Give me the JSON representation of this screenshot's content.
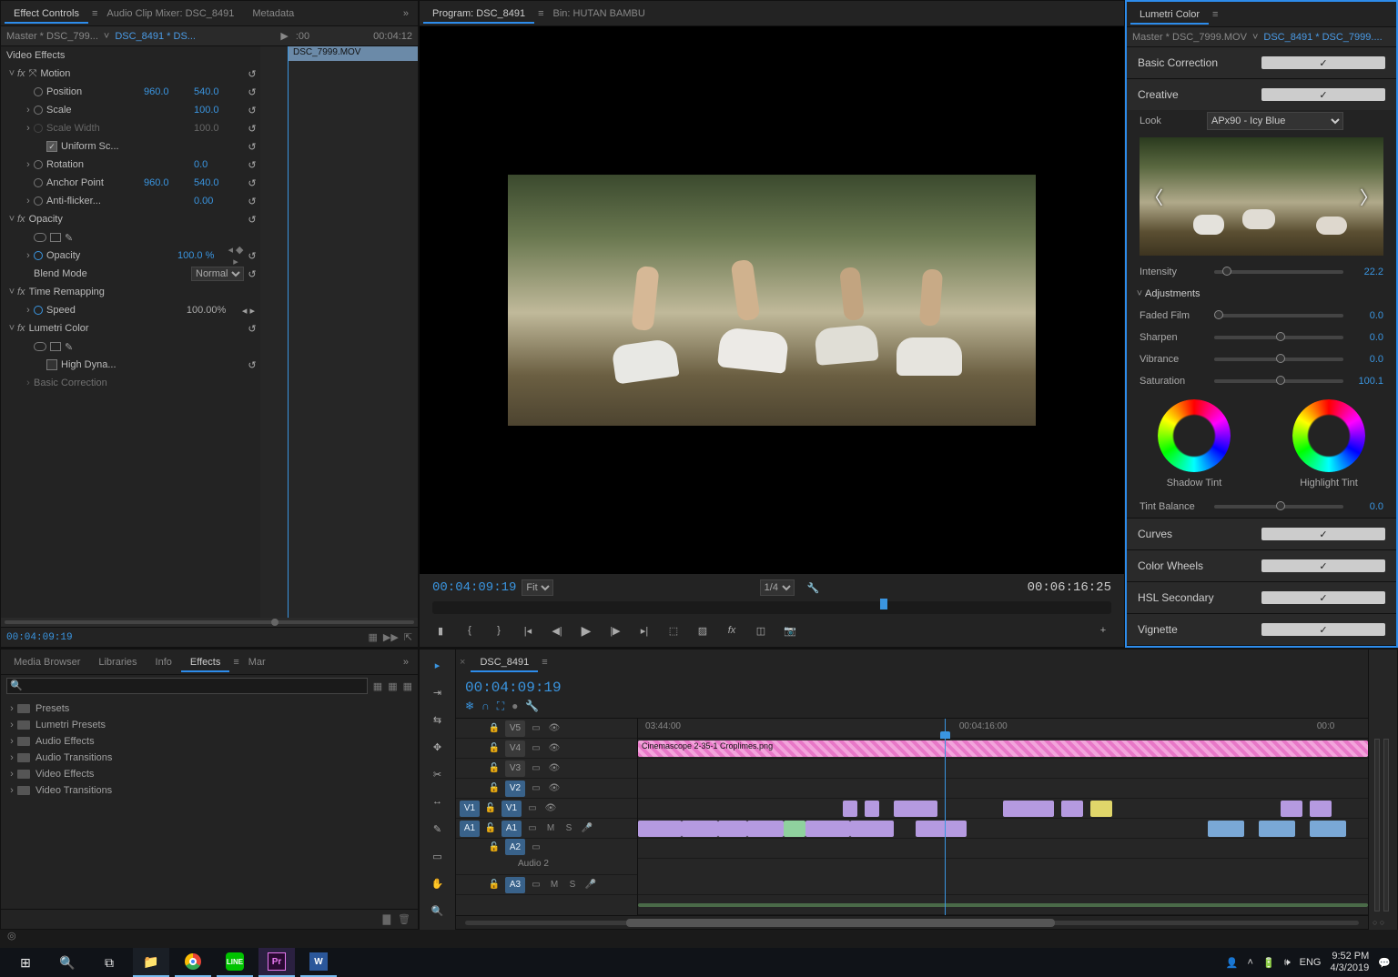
{
  "effectControls": {
    "tabs": [
      "Effect Controls",
      "Audio Clip Mixer: DSC_8491",
      "Metadata"
    ],
    "master": "Master * DSC_799...",
    "clipLink": "DSC_8491 * DS...",
    "tcStart": ":00",
    "tcEnd": "00:04:12",
    "clipName": "DSC_7999.MOV",
    "videoEffectsLabel": "Video Effects",
    "motion": {
      "label": "Motion",
      "position": "Position",
      "posX": "960.0",
      "posY": "540.0",
      "scale": "Scale",
      "scaleV": "100.0",
      "scaleW": "Scale Width",
      "scaleWV": "100.0",
      "uniform": "Uniform Sc...",
      "rotation": "Rotation",
      "rotV": "0.0",
      "anchor": "Anchor Point",
      "anchorX": "960.0",
      "anchorY": "540.0",
      "antiF": "Anti-flicker...",
      "antiFV": "0.00"
    },
    "opacity": {
      "label": "Opacity",
      "op": "Opacity",
      "opV": "100.0 %",
      "blend": "Blend Mode",
      "blendV": "Normal"
    },
    "timeRemap": {
      "label": "Time Remapping",
      "speed": "Speed",
      "speedV": "100.00%"
    },
    "lumetri": {
      "label": "Lumetri Color",
      "highDyn": "High Dyna...",
      "basic": "Basic Correction"
    },
    "tc": "00:04:09:19"
  },
  "program": {
    "tabs": [
      "Program: DSC_8491",
      "Bin: HUTAN BAMBU"
    ],
    "tc": "00:04:09:19",
    "fit": "Fit",
    "scale": "1/4",
    "dur": "00:06:16:25"
  },
  "lumetri": {
    "title": "Lumetri Color",
    "master": "Master * DSC_7999.MOV",
    "clipLink": "DSC_8491 * DSC_7999....",
    "sections": {
      "basic": "Basic Correction",
      "creative": "Creative",
      "curves": "Curves",
      "wheels": "Color Wheels",
      "hsl": "HSL Secondary",
      "vignette": "Vignette"
    },
    "lookLabel": "Look",
    "lookValue": "APx90 - Icy Blue",
    "intensity": {
      "label": "Intensity",
      "value": "22.2"
    },
    "adjustments": "Adjustments",
    "faded": {
      "label": "Faded Film",
      "value": "0.0"
    },
    "sharpen": {
      "label": "Sharpen",
      "value": "0.0"
    },
    "vibrance": {
      "label": "Vibrance",
      "value": "0.0"
    },
    "saturation": {
      "label": "Saturation",
      "value": "100.1"
    },
    "shadowTint": "Shadow Tint",
    "highlightTint": "Highlight Tint",
    "tintBalance": {
      "label": "Tint Balance",
      "value": "0.0"
    }
  },
  "effects": {
    "tabs": [
      "Media Browser",
      "Libraries",
      "Info",
      "Effects",
      "Mar"
    ],
    "items": [
      "Presets",
      "Lumetri Presets",
      "Audio Effects",
      "Audio Transitions",
      "Video Effects",
      "Video Transitions"
    ]
  },
  "timeline": {
    "seqTab": "DSC_8491",
    "tc": "00:04:09:19",
    "ruler": [
      "03:44:00",
      "00:04:16:00",
      "00:0"
    ],
    "tracks": {
      "v5": "V5",
      "v4": "V4",
      "v3": "V3",
      "v2": "V2",
      "v1": "V1",
      "a1": "A1",
      "a2": "A2",
      "a2label": "Audio 2",
      "a3": "A3"
    },
    "pinkClip": "Cinemascope 2-35-1 Croplimes.png"
  },
  "taskbar": {
    "lang": "ENG",
    "time": "9:52 PM",
    "date": "4/3/2019"
  }
}
